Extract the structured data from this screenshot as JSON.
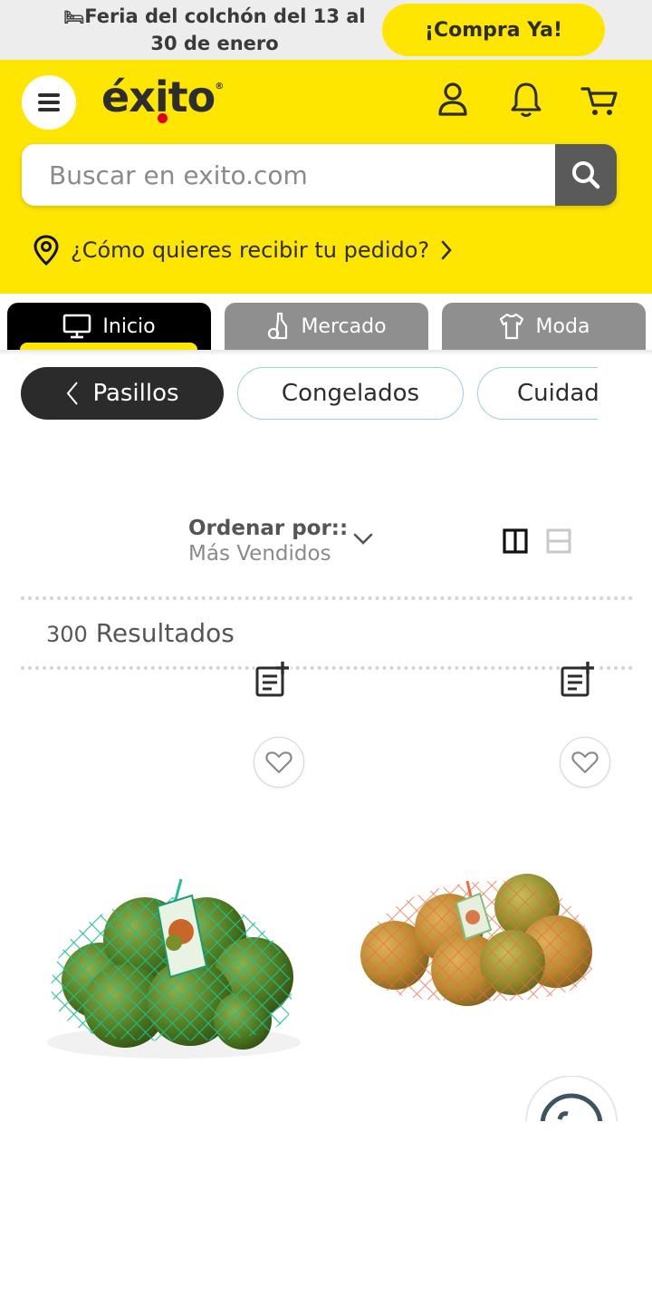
{
  "promo": {
    "icon": "bed-icon",
    "text": "Feria del colchón del 13 al 30 de enero",
    "button": "¡Compra Ya!"
  },
  "header": {
    "logo": "éxito",
    "logo_reg": "®",
    "brand_color": "#ffe600",
    "search_placeholder": "Buscar en exito.com",
    "delivery": "¿Cómo quieres recibir tu pedido?"
  },
  "tabs": [
    {
      "label": "Inicio",
      "icon": "monitor-icon",
      "active": true
    },
    {
      "label": "Mercado",
      "icon": "bottle-icon",
      "active": false
    },
    {
      "label": "Moda",
      "icon": "shirt-icon",
      "active": false
    }
  ],
  "chips": [
    {
      "label": "Pasillos",
      "active": true
    },
    {
      "label": "Congelados",
      "active": false
    },
    {
      "label": "Cuidado",
      "active": false
    }
  ],
  "sort": {
    "label": "Ordenar por::",
    "value": "Más Vendidos"
  },
  "results": {
    "count": "300",
    "label": "Resultados"
  },
  "products": [
    {
      "name": "green-mandarins-mesh-bag",
      "net_color": "#1bb18a"
    },
    {
      "name": "orange-mandarins-mesh-bag",
      "net_color": "#e85a3a"
    }
  ]
}
